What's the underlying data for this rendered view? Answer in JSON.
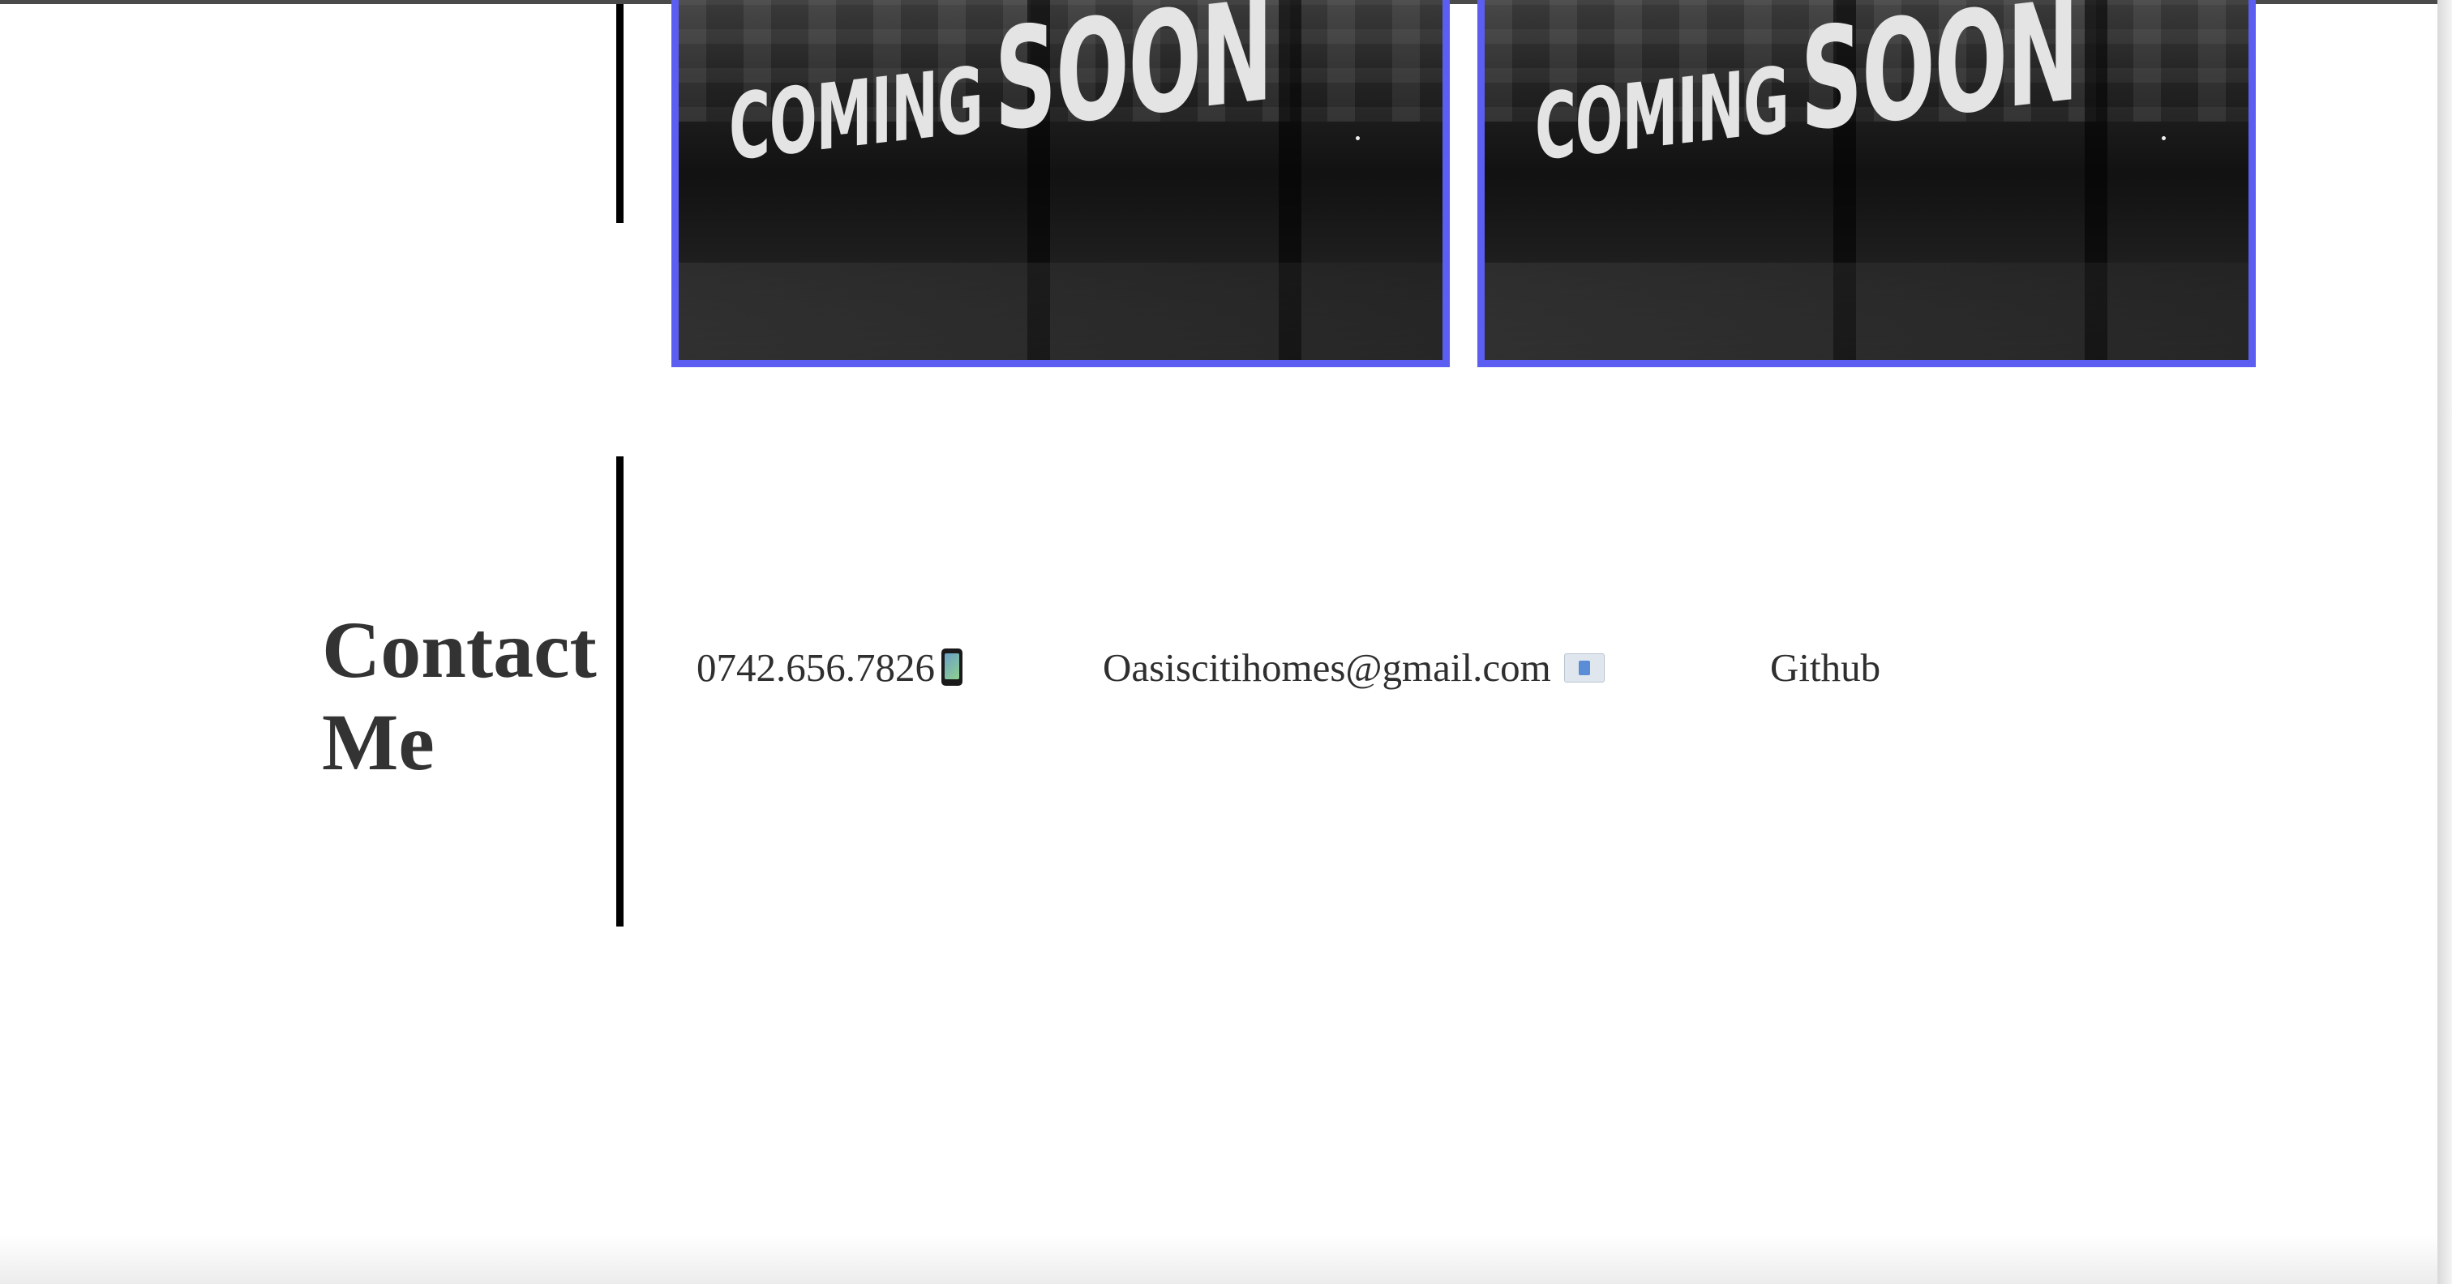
{
  "projects": {
    "cards": [
      {
        "image_text_line1": "COMING",
        "image_text_line2": "SOON"
      },
      {
        "image_text_line1": "COMING",
        "image_text_line2": "SOON"
      }
    ],
    "accent_color": "#5b5ef0"
  },
  "contact": {
    "heading_line1": "Contact",
    "heading_line2": "Me",
    "phone": "0742.656.7826",
    "phone_icon": "mobile-phone-icon",
    "email": "Oasiscitihomes@gmail.com",
    "email_icon": "envelope-icon",
    "github_label": "Github"
  }
}
